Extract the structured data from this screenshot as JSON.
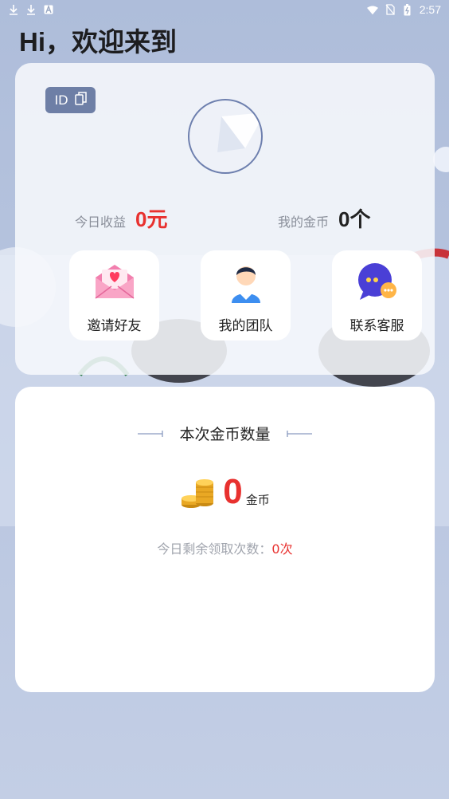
{
  "status_bar": {
    "time": "2:57",
    "left_icons": [
      "download-icon",
      "download-icon",
      "a-icon"
    ],
    "right_icons": [
      "wifi-icon",
      "no-sim-icon",
      "battery-icon"
    ]
  },
  "greeting": "Hi，欢迎来到",
  "profile": {
    "id_label": "ID",
    "copy_icon": "copy-icon",
    "income_label": "今日收益",
    "income_value": "0元",
    "coins_label": "我的金币",
    "coins_value": "0个"
  },
  "actions": [
    {
      "label": "邀请好友",
      "icon": "envelope-heart-icon"
    },
    {
      "label": "我的团队",
      "icon": "person-icon"
    },
    {
      "label": "联系客服",
      "icon": "chat-bubble-icon"
    }
  ],
  "coin_card": {
    "title": "本次金币数量",
    "amount": "0",
    "unit": "金币",
    "remaining_label": "今日剩余领取次数：",
    "remaining_value": "0次"
  },
  "colors": {
    "accent_red": "#e8312f",
    "badge_blue": "#6e7fa6",
    "background": "#c0cce4"
  }
}
